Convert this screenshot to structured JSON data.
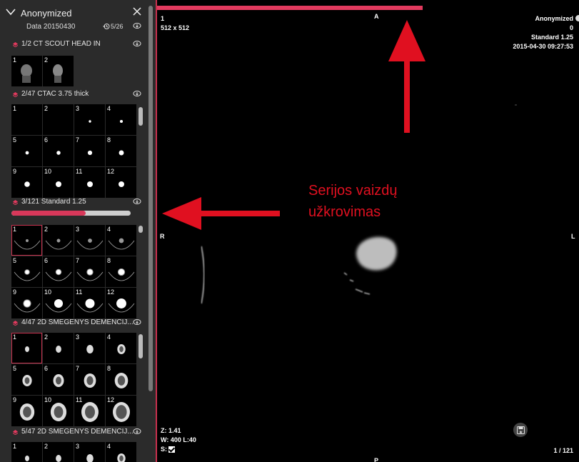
{
  "sidebar": {
    "patient": "Anonymized",
    "study_date": "Data 20150430",
    "history_count": "5/26",
    "series": [
      {
        "label": "1/2 CT SCOUT HEAD IN"
      },
      {
        "label": "2/47 CTAC 3.75 thick"
      },
      {
        "label": "3/121 Standard 1.25",
        "load_progress": 0.62
      },
      {
        "label": "4/47 2D SMEGENYS DEMENCIJ..."
      },
      {
        "label": "5/47 2D SMEGENYS DEMENCIJ..."
      }
    ],
    "thumb_numbers": [
      "1",
      "2",
      "3",
      "4",
      "5",
      "6",
      "7",
      "8",
      "9",
      "10",
      "11",
      "12"
    ],
    "scout_numbers": [
      "1",
      "2"
    ]
  },
  "viewer": {
    "top_progress": 0.63,
    "top_left": {
      "index": "1",
      "size": "512 x 512"
    },
    "top_right": {
      "patient": "Anonymized",
      "value": "0",
      "series": "Standard 1.25",
      "datetime": "2015-04-30 09:27:53"
    },
    "orient": {
      "top": "A",
      "left": "R",
      "right": "L",
      "bottom": "P"
    },
    "bottom_left": {
      "zoom": "Z: 1.41",
      "window": "W: 400 L:40",
      "sync": "S:"
    },
    "bottom_right": {
      "frame": "1 / 121"
    }
  },
  "annotation": {
    "line1": "Serijos vaizdų",
    "line2": "užkrovimas",
    "color": "#e01020"
  },
  "colors": {
    "accent": "#c8304d",
    "progress": "#e23a5e"
  }
}
